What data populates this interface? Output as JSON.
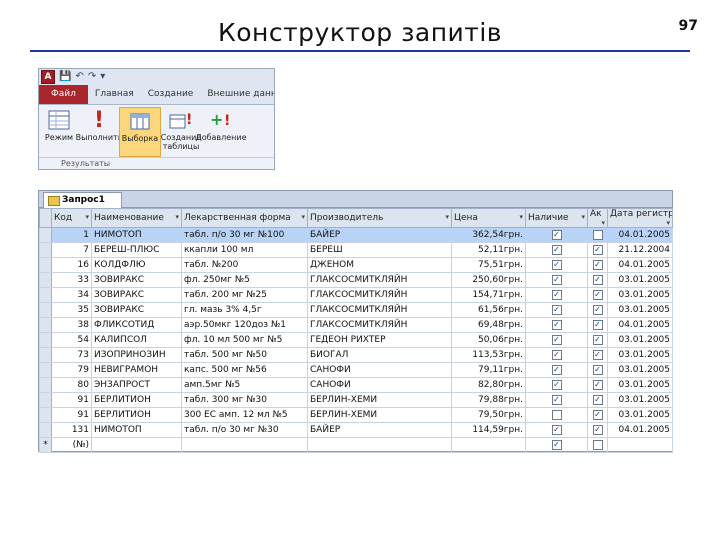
{
  "slide": {
    "title": "Конструктор запитів",
    "page_number": "97"
  },
  "ribbon": {
    "app_logo": "A",
    "tabs": {
      "file": "Файл",
      "home": "Главная",
      "create": "Создание",
      "external": "Внешние данные"
    },
    "buttons": {
      "view": "Режим",
      "run": "Выполнить",
      "select": "Выборка",
      "make_table": "Создание таблицы",
      "append": "Добавление"
    },
    "group_label": "Результаты"
  },
  "query": {
    "tab_label": "Запрос1",
    "columns": [
      "Код",
      "Наименование",
      "Лекарственная форма",
      "Производитель",
      "Цена",
      "Наличие",
      "Ак",
      "Дата регистр"
    ],
    "rows": [
      {
        "id": "1",
        "name": "НИМОТОП",
        "form": "табл. п/о 30 мг №100",
        "maker": "БАЙЕР",
        "price": "362,54грн.",
        "avail": true,
        "ak": false,
        "date": "04.01.2005"
      },
      {
        "id": "7",
        "name": "БЕРЕШ-ПЛЮС",
        "form": "ккапли 100 мл",
        "maker": "БЕРЕШ",
        "price": "52,11грн.",
        "avail": true,
        "ak": true,
        "date": "21.12.2004"
      },
      {
        "id": "16",
        "name": "КОЛДФЛЮ",
        "form": "табл. №200",
        "maker": "ДЖЕНОМ",
        "price": "75,51грн.",
        "avail": true,
        "ak": true,
        "date": "04.01.2005"
      },
      {
        "id": "33",
        "name": "ЗОВИРАКС",
        "form": "фл. 250мг №5",
        "maker": "ГЛАКСОСМИТКЛЯЙН",
        "price": "250,60грн.",
        "avail": true,
        "ak": true,
        "date": "03.01.2005"
      },
      {
        "id": "34",
        "name": "ЗОВИРАКС",
        "form": "табл. 200 мг №25",
        "maker": "ГЛАКСОСМИТКЛЯЙН",
        "price": "154,71грн.",
        "avail": true,
        "ak": true,
        "date": "03.01.2005"
      },
      {
        "id": "35",
        "name": "ЗОВИРАКС",
        "form": "гл. мазь 3% 4,5г",
        "maker": "ГЛАКСОСМИТКЛЯЙН",
        "price": "61,56грн.",
        "avail": true,
        "ak": true,
        "date": "03.01.2005"
      },
      {
        "id": "38",
        "name": "ФЛИКСОТИД",
        "form": "аэр.50мкг 120доз №1",
        "maker": "ГЛАКСОСМИТКЛЯЙН",
        "price": "69,48грн.",
        "avail": true,
        "ak": true,
        "date": "04.01.2005"
      },
      {
        "id": "54",
        "name": "КАЛИПСОЛ",
        "form": "фл. 10 мл 500 мг №5",
        "maker": "ГЕДЕОН РИХТЕР",
        "price": "50,06грн.",
        "avail": true,
        "ak": true,
        "date": "03.01.2005"
      },
      {
        "id": "73",
        "name": "ИЗОПРИНОЗИН",
        "form": "табл. 500 мг №50",
        "maker": "БИОГАЛ",
        "price": "113,53грн.",
        "avail": true,
        "ak": true,
        "date": "03.01.2005"
      },
      {
        "id": "79",
        "name": "НЕВИГРАМОН",
        "form": "капс. 500 мг №56",
        "maker": "САНОФИ",
        "price": "79,11грн.",
        "avail": true,
        "ak": true,
        "date": "03.01.2005"
      },
      {
        "id": "80",
        "name": "ЭНЗАПРОСТ",
        "form": "амп.5мг №5",
        "maker": "САНОФИ",
        "price": "82,80грн.",
        "avail": true,
        "ak": true,
        "date": "03.01.2005"
      },
      {
        "id": "91",
        "name": "БЕРЛИТИОН",
        "form": "табл. 300 мг №30",
        "maker": "БЕРЛИН-ХЕМИ",
        "price": "79,88грн.",
        "avail": true,
        "ak": true,
        "date": "03.01.2005"
      },
      {
        "id": "91",
        "name": "БЕРЛИТИОН",
        "form": "300 ЕС амп. 12 мл №5",
        "maker": "БЕРЛИН-ХЕМИ",
        "price": "79,50грн.",
        "avail": false,
        "ak": true,
        "date": "03.01.2005"
      },
      {
        "id": "131",
        "name": "НИМОТОП",
        "form": "табл. п/о 30 мг №30",
        "maker": "БАЙЕР",
        "price": "114,59грн.",
        "avail": true,
        "ak": true,
        "date": "04.01.2005"
      }
    ],
    "new_row": {
      "marker": "*",
      "id": "(№)",
      "avail": true,
      "ak": false
    }
  }
}
